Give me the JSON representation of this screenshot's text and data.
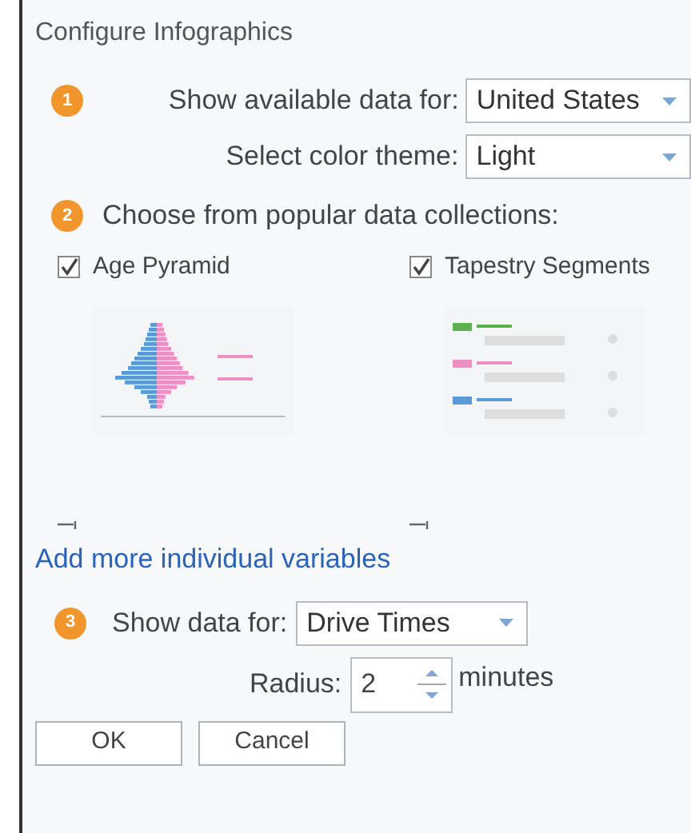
{
  "title": "Configure Infographics",
  "step1": {
    "number": "1",
    "rows": [
      {
        "label": "Show available data for:",
        "value": "United States"
      },
      {
        "label": "Select color theme:",
        "value": "Light"
      }
    ]
  },
  "step2": {
    "number": "2",
    "label": "Choose from popular data collections:",
    "collections": [
      {
        "label": "Age Pyramid",
        "checked": true,
        "kind": "pyramid"
      },
      {
        "label": "Tapestry Segments",
        "checked": true,
        "kind": "tapestry"
      }
    ]
  },
  "link": "Add more individual variables",
  "step3": {
    "number": "3",
    "label": "Show data for:",
    "value": "Drive Times",
    "radius_label": "Radius:",
    "radius": "2",
    "unit": "minutes"
  },
  "buttons": [
    "OK",
    "Cancel"
  ]
}
